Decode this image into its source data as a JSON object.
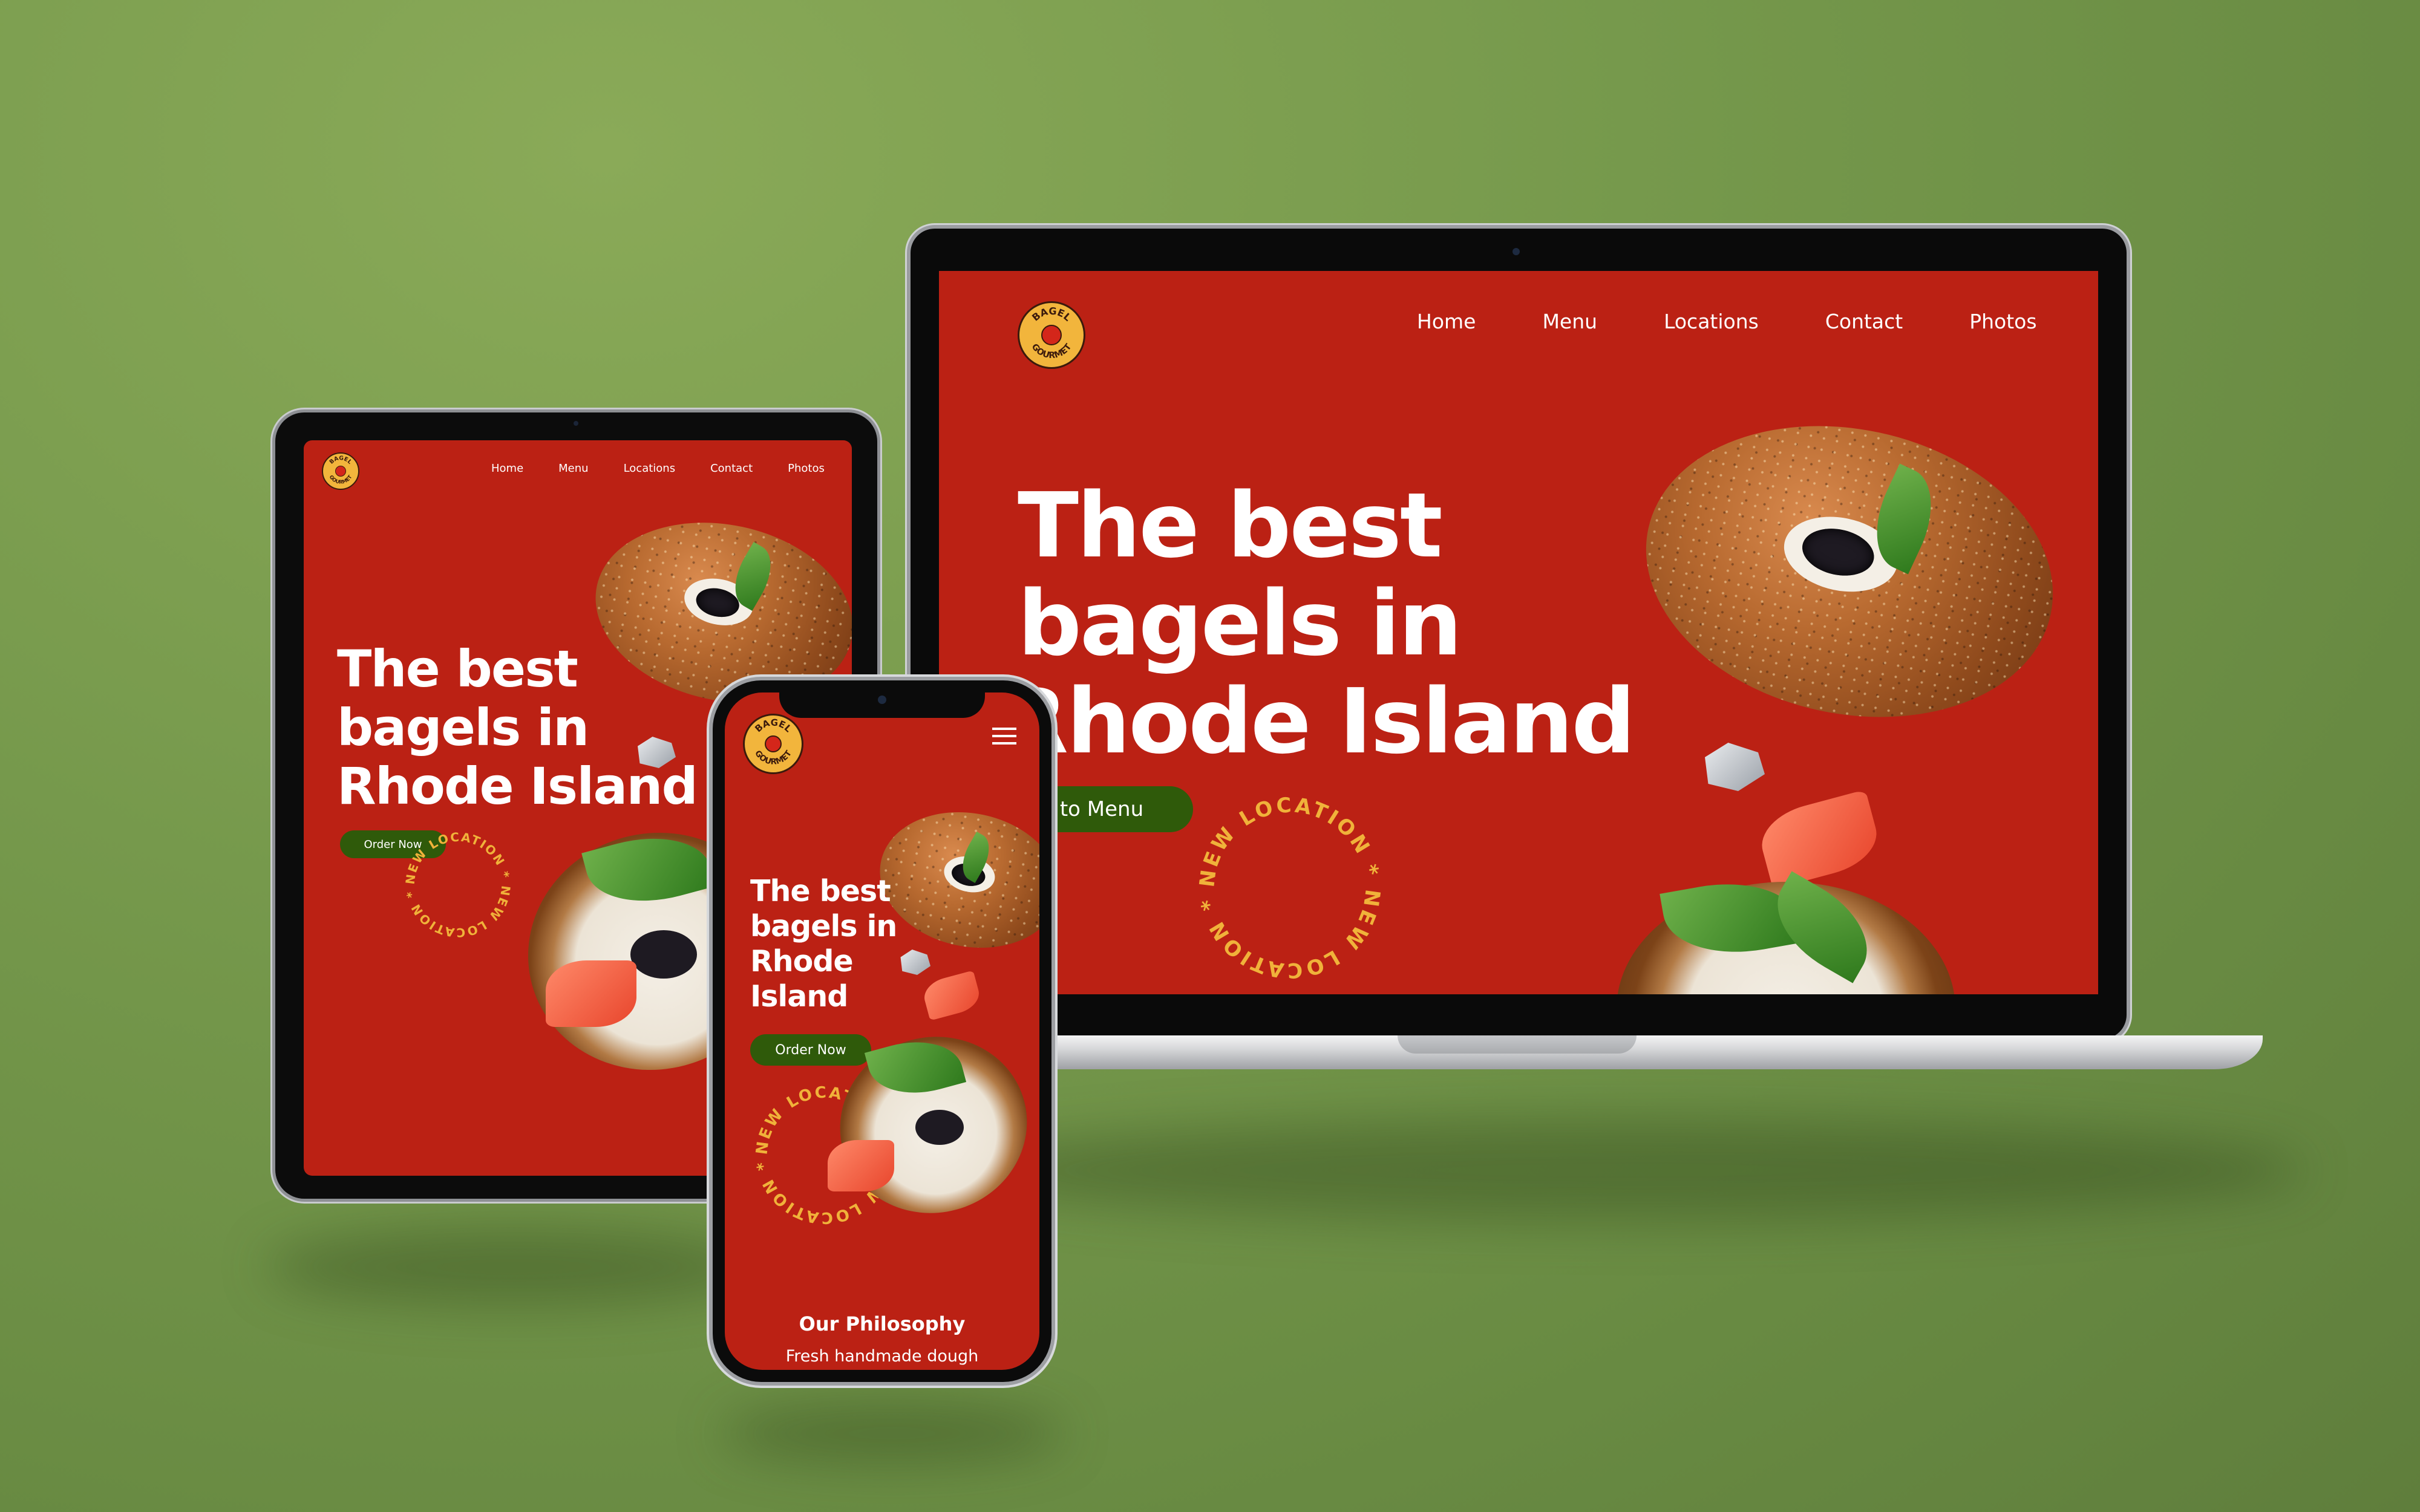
{
  "site": {
    "brand_line1": "BAGEL",
    "brand_line2": "GOURMET",
    "nav": [
      "Home",
      "Menu",
      "Locations",
      "Contact",
      "Photos"
    ],
    "hero_line1": "The best",
    "hero_line2": "bagels in",
    "hero_line3": "Rhode Island",
    "hero_phone_line1": "The best",
    "hero_phone_line2": "bagels in",
    "hero_phone_line3": "Rhode",
    "hero_phone_line4": "Island",
    "laptop_cta": "Go to Menu",
    "order_cta": "Order Now",
    "badge_text": "NEW LOCATION * NEW LOCATION *",
    "philosophy_title": "Our Philosophy",
    "philosophy_text": "Fresh handmade dough"
  },
  "colors": {
    "background": "#76994c",
    "site_red": "#bb2114",
    "button_green": "#2f5a0a",
    "logo_yellow": "#f2b53c",
    "badge_yellow": "#f0b23a"
  },
  "icons": [
    "hamburger-menu-icon",
    "logo-icon",
    "camera-notch"
  ]
}
